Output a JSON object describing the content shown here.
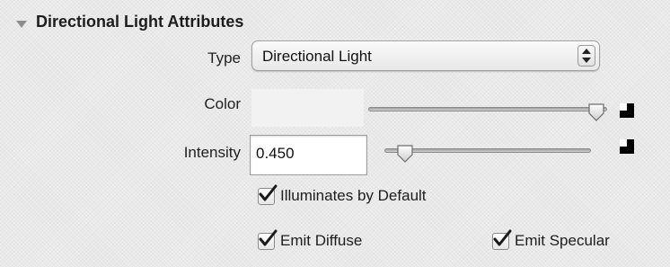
{
  "panel": {
    "section_title": "Directional Light Attributes",
    "expanded": true
  },
  "type_row": {
    "label": "Type",
    "selected": "Directional Light"
  },
  "color_row": {
    "label": "Color",
    "slider_fraction": 0.99
  },
  "intensity_row": {
    "label": "Intensity",
    "value": "0.450",
    "slider_fraction": 0.06
  },
  "checkboxes": {
    "illuminates_by_default": {
      "label": "Illuminates by Default",
      "checked": true
    },
    "emit_diffuse": {
      "label": "Emit Diffuse",
      "checked": true
    },
    "emit_specular": {
      "label": "Emit Specular",
      "checked": true
    }
  },
  "icons": {
    "section_toggle": "disclosure-triangle-icon",
    "type_select": "up-down-arrows-icon",
    "color_reset": "checker-map-icon",
    "intensity_reset": "checker-map-icon",
    "checkmark": "checkmark-icon"
  }
}
